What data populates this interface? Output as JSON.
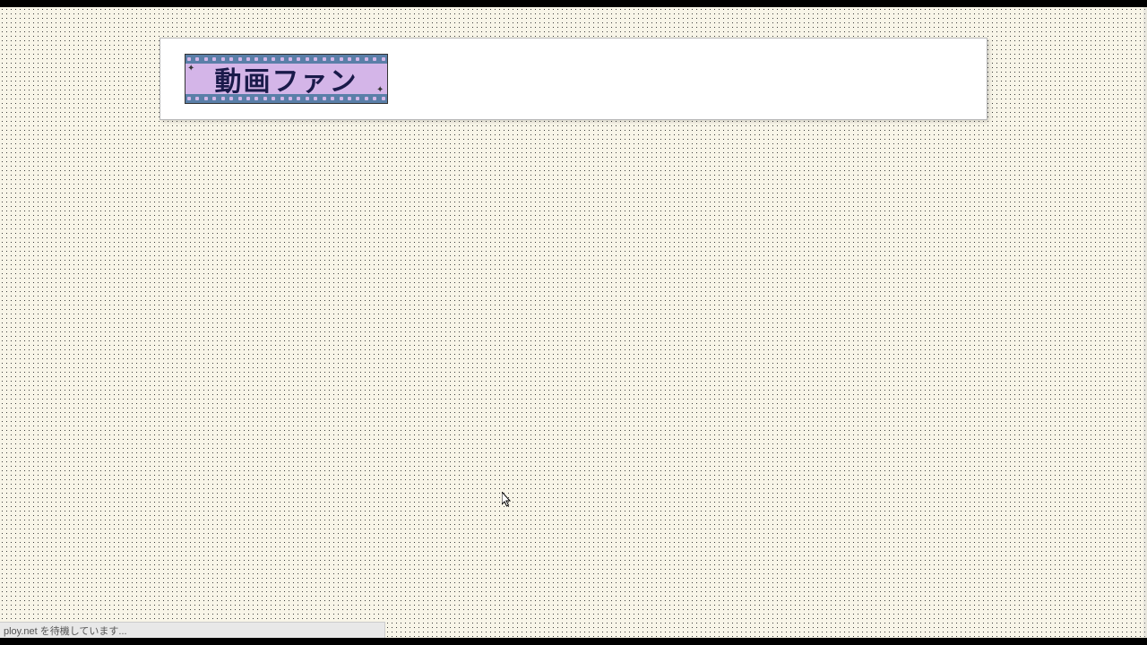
{
  "logo": {
    "text": "動画ファン"
  },
  "status": {
    "text": "ploy.net を待機しています..."
  }
}
